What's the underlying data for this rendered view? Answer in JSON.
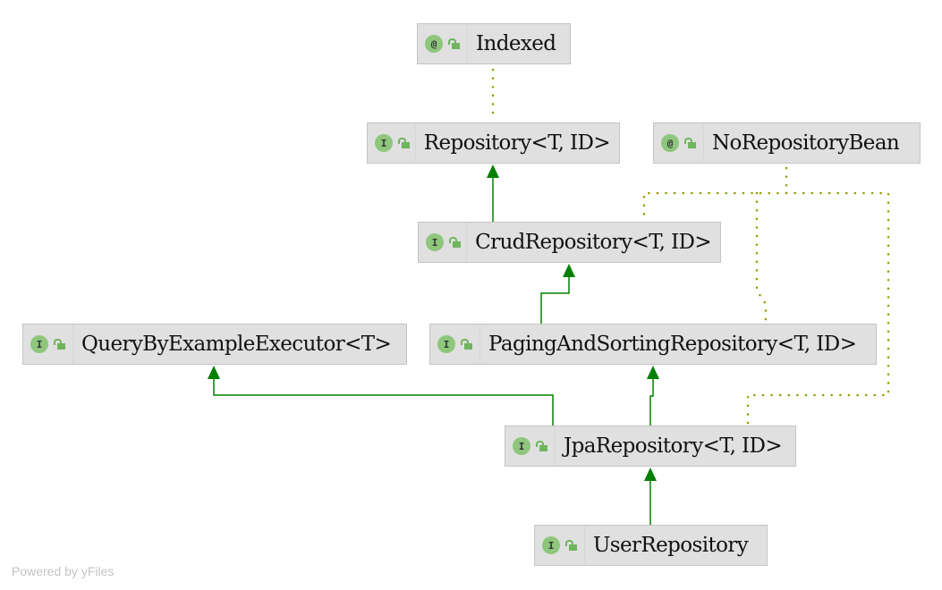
{
  "nodes": {
    "indexed": {
      "kind": "@",
      "name": "Indexed"
    },
    "repository": {
      "kind": "I",
      "name": "Repository<T, ID>"
    },
    "no_repository_bean": {
      "kind": "@",
      "name": "NoRepositoryBean"
    },
    "crud_repository": {
      "kind": "I",
      "name": "CrudRepository<T, ID>"
    },
    "query_by_example": {
      "kind": "I",
      "name": "QueryByExampleExecutor<T>"
    },
    "paging_and_sorting": {
      "kind": "I",
      "name": "PagingAndSortingRepository<T, ID>"
    },
    "jpa_repository": {
      "kind": "I",
      "name": "JpaRepository<T, ID>"
    },
    "user_repository": {
      "kind": "I",
      "name": "UserRepository"
    }
  },
  "edges": [
    {
      "from": "Repository<T, ID>",
      "to": "Indexed",
      "type": "annotation"
    },
    {
      "from": "CrudRepository<T, ID>",
      "to": "Repository<T, ID>",
      "type": "extends"
    },
    {
      "from": "PagingAndSortingRepository<T, ID>",
      "to": "CrudRepository<T, ID>",
      "type": "extends"
    },
    {
      "from": "JpaRepository<T, ID>",
      "to": "QueryByExampleExecutor<T>",
      "type": "extends"
    },
    {
      "from": "JpaRepository<T, ID>",
      "to": "PagingAndSortingRepository<T, ID>",
      "type": "extends"
    },
    {
      "from": "UserRepository",
      "to": "JpaRepository<T, ID>",
      "type": "extends"
    },
    {
      "from": "CrudRepository<T, ID>",
      "to": "NoRepositoryBean",
      "type": "annotation"
    },
    {
      "from": "PagingAndSortingRepository<T, ID>",
      "to": "NoRepositoryBean",
      "type": "annotation"
    },
    {
      "from": "JpaRepository<T, ID>",
      "to": "NoRepositoryBean",
      "type": "annotation"
    }
  ],
  "colors": {
    "extends": "#008000",
    "annotation": "#999900",
    "node_bg": "#e0e0e0",
    "icon": "#8ec67c"
  },
  "footer": "Powered by yFiles"
}
